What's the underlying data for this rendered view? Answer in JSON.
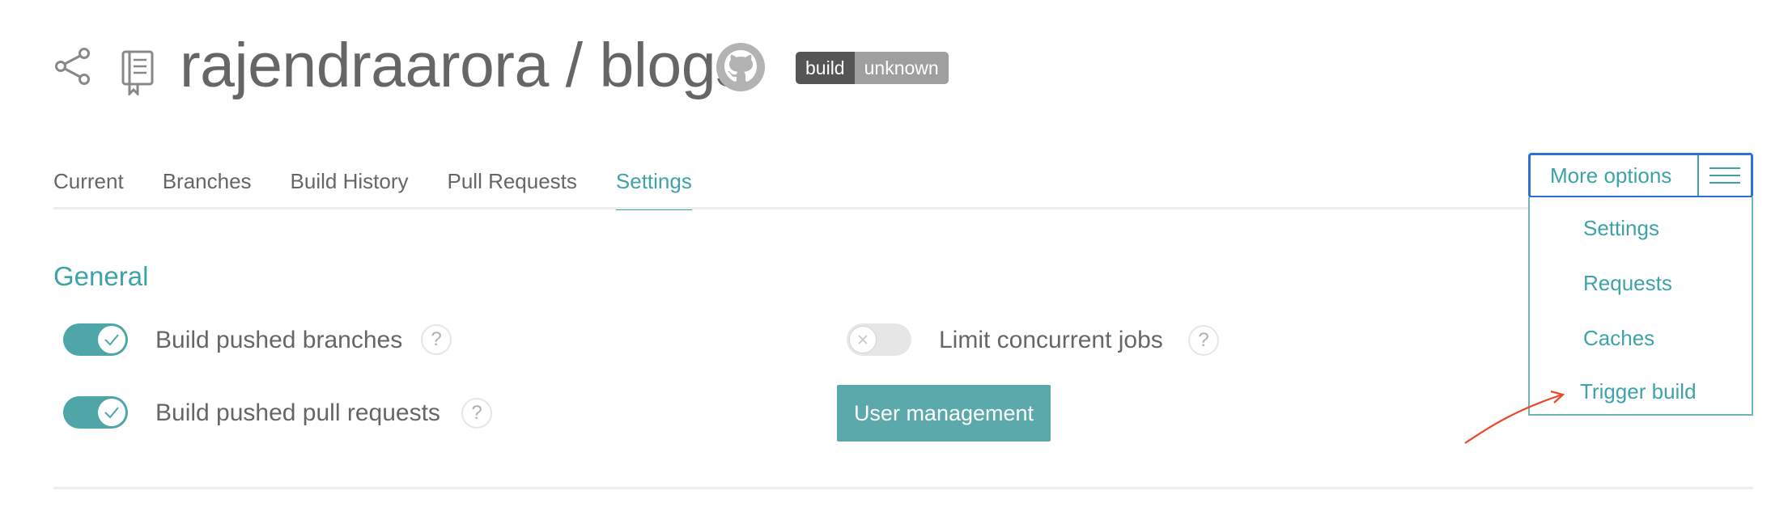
{
  "header": {
    "repo_title": "rajendraarora / blogs",
    "badge": {
      "left": "build",
      "right": "unknown"
    },
    "icons": [
      "share-icon",
      "repo-icon",
      "github-icon"
    ]
  },
  "tabs": [
    {
      "label": "Current"
    },
    {
      "label": "Branches"
    },
    {
      "label": "Build History"
    },
    {
      "label": "Pull Requests"
    },
    {
      "label": "Settings",
      "active": true
    }
  ],
  "general": {
    "title": "General",
    "settings": [
      {
        "label": "Build pushed branches",
        "enabled": true
      },
      {
        "label": "Build pushed pull requests",
        "enabled": true
      },
      {
        "label": "Limit concurrent jobs",
        "enabled": false
      }
    ],
    "help_glyph": "?",
    "user_management_button": "User management"
  },
  "more_options": {
    "label": "More options",
    "items": [
      "Settings",
      "Requests",
      "Caches",
      "Trigger build"
    ]
  },
  "colors": {
    "accent": "#3ea3a8",
    "toggle_on": "#4ea6a9",
    "button": "#5ba9ab",
    "dropdown_border": "#2f6fd6",
    "annotation_arrow": "#e8492a",
    "text": "#666666"
  }
}
